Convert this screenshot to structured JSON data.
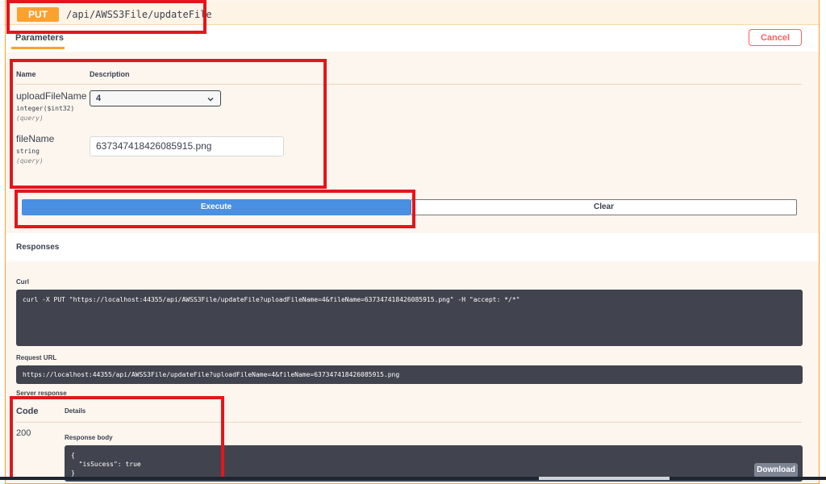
{
  "operation": {
    "method": "PUT",
    "path": "/api/AWSS3File/updateFile"
  },
  "tabs": {
    "parameters": "Parameters",
    "cancel": "Cancel"
  },
  "table": {
    "name_header": "Name",
    "description_header": "Description"
  },
  "params": [
    {
      "name": "uploadFileName",
      "type": "integer($int32)",
      "in": "(query)",
      "value": "4"
    },
    {
      "name": "fileName",
      "type": "string",
      "in": "(query)",
      "value": "637347418426085915.png"
    }
  ],
  "actions": {
    "execute": "Execute",
    "clear": "Clear"
  },
  "responses": {
    "title": "Responses",
    "curl_label": "Curl",
    "curl": "curl -X PUT \"https://localhost:44355/api/AWSS3File/updateFile?uploadFileName=4&fileName=637347418426085915.png\" -H \"accept: */*\"",
    "request_url_label": "Request URL",
    "request_url": "https://localhost:44355/api/AWSS3File/updateFile?uploadFileName=4&fileName=637347418426085915.png",
    "server_response_label": "Server response",
    "code_header": "Code",
    "details_header": "Details",
    "code": "200",
    "response_body_label": "Response body",
    "response_body": "{\n  \"isSucess\": true\n}",
    "download": "Download"
  },
  "colors": {
    "put": "#fca130",
    "execute": "#4990e2",
    "highlight": "#e5151c"
  },
  "icons": {
    "select_chevron": "chevron-down-icon"
  }
}
